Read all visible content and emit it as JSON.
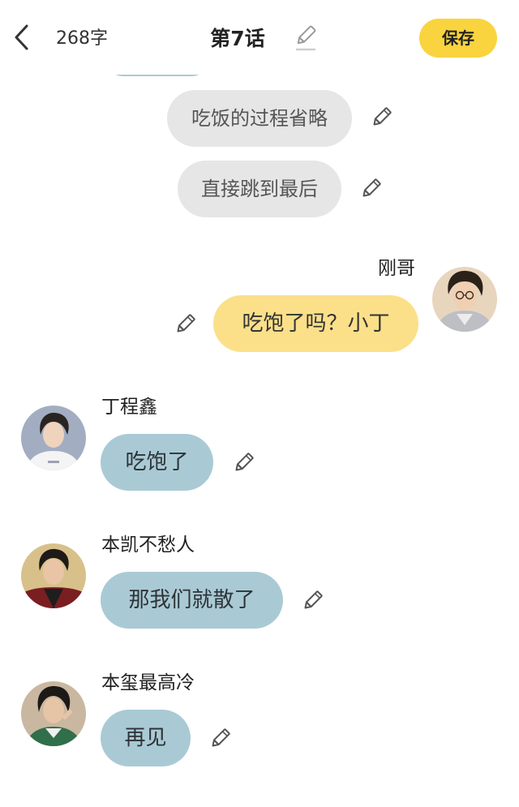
{
  "header": {
    "word_count": "268字",
    "title": "第7话",
    "save_label": "保存"
  },
  "messages": [
    {
      "type": "narration",
      "text": "吃饭的过程省略"
    },
    {
      "type": "narration",
      "text": "直接跳到最后"
    },
    {
      "type": "sent",
      "name": "刚哥",
      "text": "吃饱了吗？小丁"
    },
    {
      "type": "received",
      "name": "丁程鑫",
      "text": "吃饱了"
    },
    {
      "type": "received",
      "name": "本凯不愁人",
      "text": "那我们就散了"
    },
    {
      "type": "received",
      "name": "本玺最高冷",
      "text": "再见"
    }
  ],
  "colors": {
    "accent": "#f9d43f",
    "sent_bubble": "#fbe089",
    "received_bubble": "#a9cad4",
    "narration_bubble": "#e6e6e6"
  }
}
